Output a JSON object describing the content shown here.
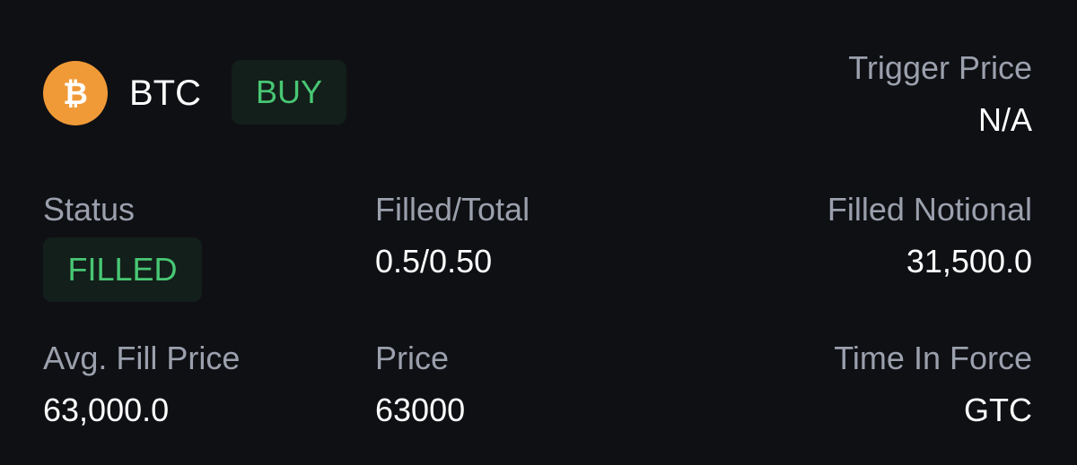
{
  "header": {
    "symbol": "BTC",
    "side": "BUY",
    "coin_icon": "bitcoin-icon",
    "coin_color": "#f09a37"
  },
  "trigger_price": {
    "label": "Trigger Price",
    "value": "N/A"
  },
  "status": {
    "label": "Status",
    "value": "FILLED",
    "color": "#48c774"
  },
  "filled_total": {
    "label": "Filled/Total",
    "value": "0.5/0.50"
  },
  "filled_notional": {
    "label": "Filled Notional",
    "value": "31,500.0"
  },
  "avg_fill_price": {
    "label": "Avg. Fill Price",
    "value": "63,000.0"
  },
  "price": {
    "label": "Price",
    "value": "63000"
  },
  "time_in_force": {
    "label": "Time In Force",
    "value": "GTC"
  },
  "colors": {
    "background": "#0f1014",
    "label": "#9ba0ad",
    "value": "#ffffff",
    "positive": "#48c774"
  }
}
